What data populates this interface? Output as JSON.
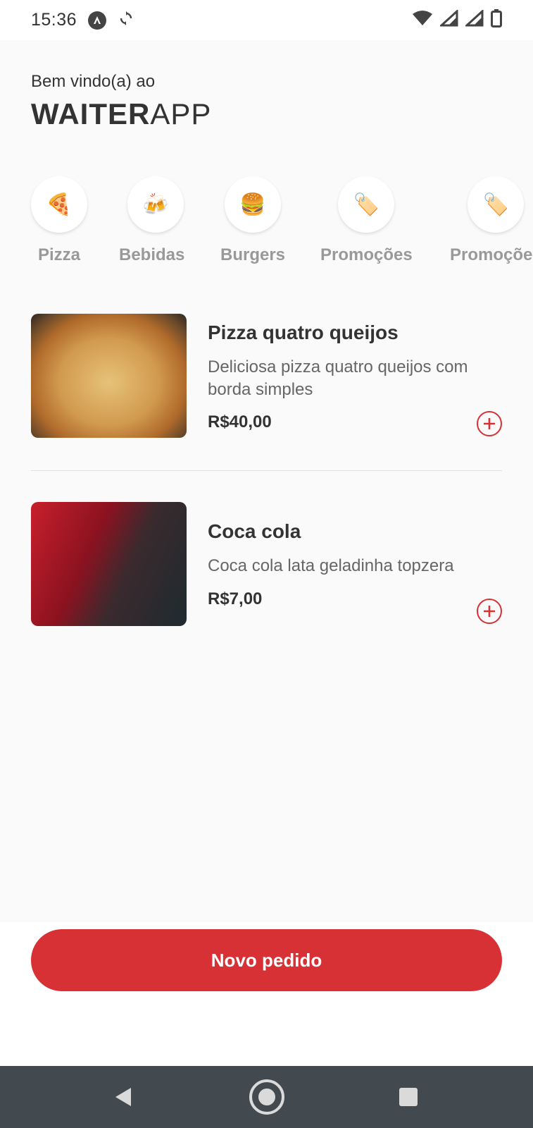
{
  "status_bar": {
    "time": "15:36",
    "icons": [
      "app-notification-icon",
      "sync-icon",
      "wifi-icon",
      "signal-icon",
      "signal-icon",
      "battery-icon"
    ]
  },
  "header": {
    "greeting": "Bem vindo(a) ao",
    "brand_bold": "WAITER",
    "brand_light": "APP"
  },
  "categories": [
    {
      "icon": "🍕",
      "label": "Pizza"
    },
    {
      "icon": "🍻",
      "label": "Bebidas"
    },
    {
      "icon": "🍔",
      "label": "Burgers"
    },
    {
      "icon": "🏷️",
      "label": "Promoções"
    },
    {
      "icon": "🏷️",
      "label": "Promoções"
    }
  ],
  "products": [
    {
      "name": "Pizza quatro queijos",
      "description": "Deliciosa pizza quatro queijos com borda simples",
      "price": "R$40,00"
    },
    {
      "name": "Coca cola",
      "description": "Coca cola lata geladinha topzera",
      "price": "R$7,00"
    }
  ],
  "footer": {
    "new_order_label": "Novo pedido"
  },
  "colors": {
    "accent": "#D73035",
    "text": "#333333",
    "muted": "#666666",
    "background": "#FAFAFA",
    "nav_bar": "#424A50"
  }
}
